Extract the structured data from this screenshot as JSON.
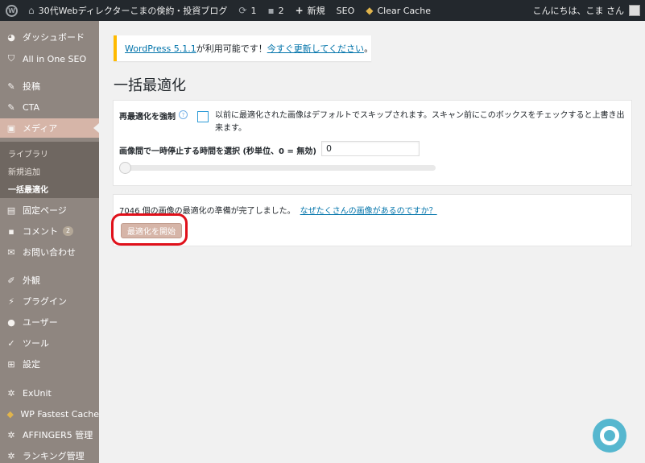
{
  "adminbar": {
    "site_name": "30代Webディレクターこまの倹約・投資ブログ",
    "updates_count": "1",
    "comments_count": "2",
    "new_label": "新規",
    "seo_label": "SEO",
    "clear_cache_label": "Clear Cache",
    "greeting": "こんにちは、こま さん"
  },
  "sidebar": {
    "items": [
      {
        "label": "ダッシュボード"
      },
      {
        "label": "All in One SEO"
      },
      {
        "label": "投稿"
      },
      {
        "label": "CTA"
      },
      {
        "label": "メディア"
      },
      {
        "label": "固定ページ"
      },
      {
        "label": "コメント",
        "badge": "2"
      },
      {
        "label": "お問い合わせ"
      },
      {
        "label": "外観"
      },
      {
        "label": "プラグイン"
      },
      {
        "label": "ユーザー"
      },
      {
        "label": "ツール"
      },
      {
        "label": "設定"
      },
      {
        "label": "ExUnit"
      },
      {
        "label": "WP Fastest Cache"
      },
      {
        "label": "AFFINGER5 管理"
      },
      {
        "label": "ランキング管理"
      }
    ],
    "media_submenu": [
      "ライブラリ",
      "新規追加",
      "一括最適化"
    ]
  },
  "notice": {
    "version_link": "WordPress 5.1.1",
    "text": " が利用可能です！",
    "update_link": "今すぐ更新してください",
    "end": "。"
  },
  "page": {
    "title": "一括最適化",
    "force_label": "再最適化を強制",
    "force_desc": "以前に最適化された画像はデフォルトでスキップされます。スキャン前にこのボックスをチェックすると上書き出来ます。",
    "pause_label": "画像間で一時停止する時間を選択 (秒単位、0 = 無効)",
    "pause_value": "0",
    "status_text": "7046 個の画像の最適化の準備が完了しました。",
    "status_link": "なぜたくさんの画像があるのですか？",
    "start_button": "最適化を開始"
  },
  "colors": {
    "adminbar": "#23282d",
    "sidebar": "#8f8680",
    "active_menu": "#d6b5a8",
    "highlight": "#e0101a",
    "help_bubble": "#56b7cf"
  }
}
